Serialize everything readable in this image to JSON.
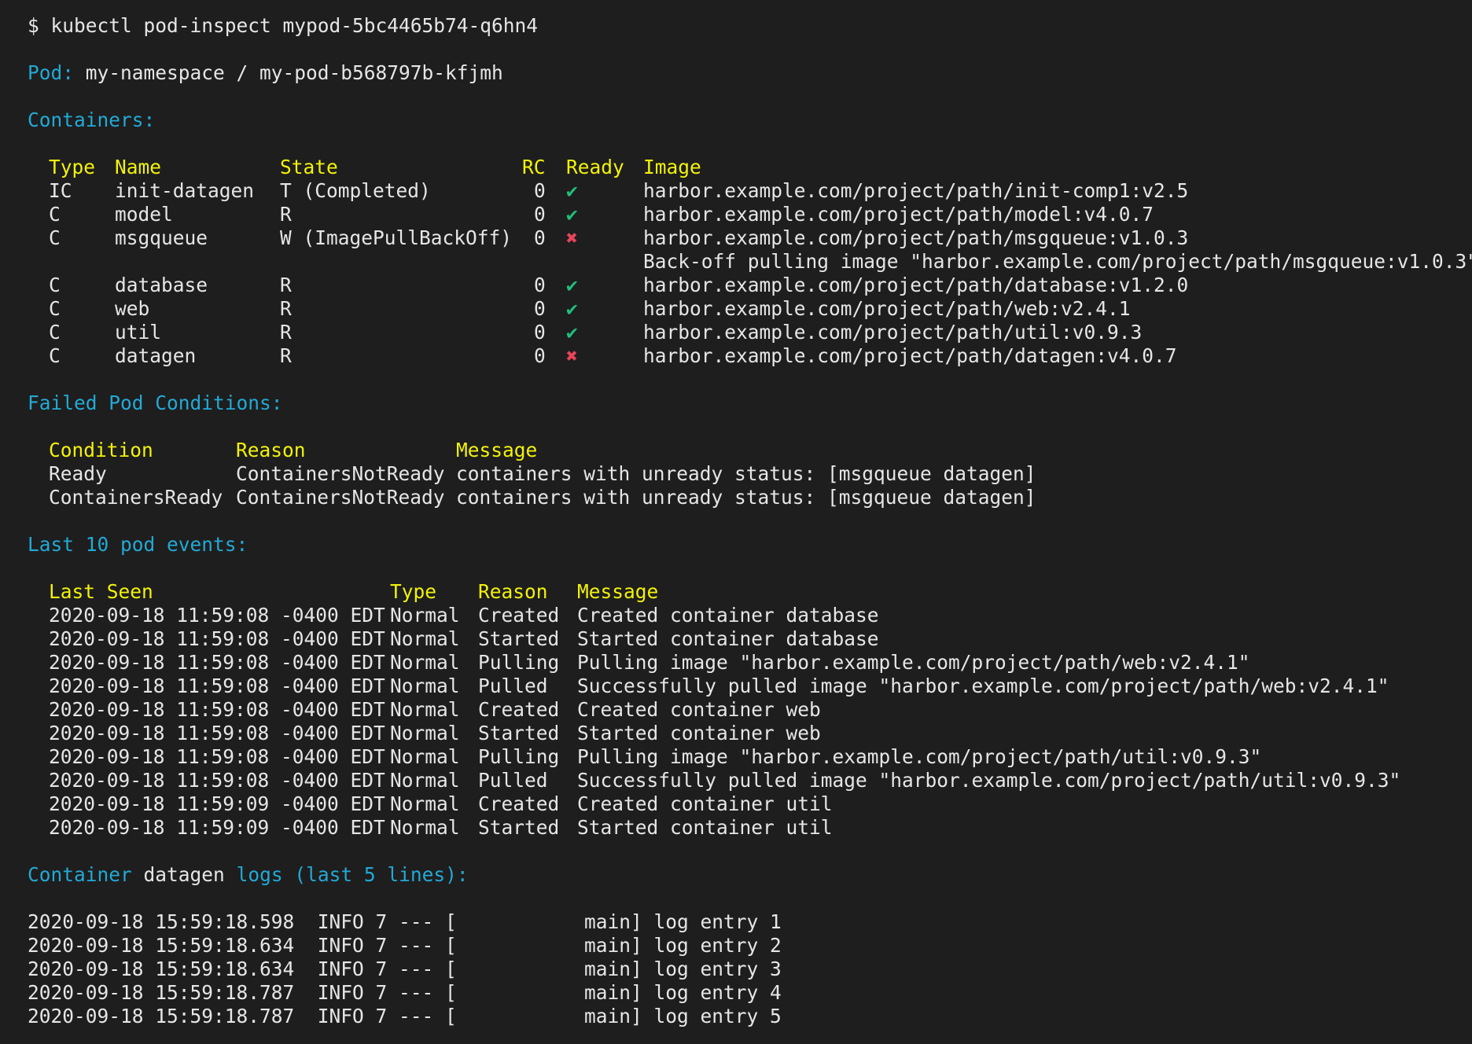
{
  "command": {
    "prompt": "$",
    "text": "kubectl pod-inspect mypod-5bc4465b74-q6hn4"
  },
  "pod": {
    "label": "Pod:",
    "value": "my-namespace / my-pod-b568797b-kfjmh"
  },
  "containers": {
    "heading": "Containers:",
    "headers": {
      "type": "Type",
      "name": "Name",
      "state": "State",
      "rc": "RC",
      "ready": "Ready",
      "image": "Image"
    },
    "rows": [
      {
        "type": "IC",
        "name": "init-datagen",
        "state": "T (Completed)",
        "rc": "0",
        "ready": "✔",
        "ready_ok": true,
        "image": "harbor.example.com/project/path/init-comp1:v2.5"
      },
      {
        "type": "C",
        "name": "model",
        "state": "R",
        "rc": "0",
        "ready": "✔",
        "ready_ok": true,
        "image": "harbor.example.com/project/path/model:v4.0.7"
      },
      {
        "type": "C",
        "name": "msgqueue",
        "state": "W (ImagePullBackOff)",
        "rc": "0",
        "ready": "✖",
        "ready_ok": false,
        "image": "harbor.example.com/project/path/msgqueue:v1.0.3",
        "detail": "Back-off pulling image \"harbor.example.com/project/path/msgqueue:v1.0.3\""
      },
      {
        "type": "C",
        "name": "database",
        "state": "R",
        "rc": "0",
        "ready": "✔",
        "ready_ok": true,
        "image": "harbor.example.com/project/path/database:v1.2.0"
      },
      {
        "type": "C",
        "name": "web",
        "state": "R",
        "rc": "0",
        "ready": "✔",
        "ready_ok": true,
        "image": "harbor.example.com/project/path/web:v2.4.1"
      },
      {
        "type": "C",
        "name": "util",
        "state": "R",
        "rc": "0",
        "ready": "✔",
        "ready_ok": true,
        "image": "harbor.example.com/project/path/util:v0.9.3"
      },
      {
        "type": "C",
        "name": "datagen",
        "state": "R",
        "rc": "0",
        "ready": "✖",
        "ready_ok": false,
        "image": "harbor.example.com/project/path/datagen:v4.0.7"
      }
    ]
  },
  "conditions": {
    "heading": "Failed Pod Conditions:",
    "headers": {
      "condition": "Condition",
      "reason": "Reason",
      "message": "Message"
    },
    "rows": [
      {
        "condition": "Ready",
        "reason": "ContainersNotReady",
        "message": "containers with unready status: [msgqueue datagen]"
      },
      {
        "condition": "ContainersReady",
        "reason": "ContainersNotReady",
        "message": "containers with unready status: [msgqueue datagen]"
      }
    ]
  },
  "events": {
    "heading": "Last 10 pod events:",
    "headers": {
      "last_seen": "Last Seen",
      "type": "Type",
      "reason": "Reason",
      "message": "Message"
    },
    "rows": [
      {
        "last_seen": "2020-09-18 11:59:08 -0400 EDT",
        "type": "Normal",
        "reason": "Created",
        "message": "Created container database"
      },
      {
        "last_seen": "2020-09-18 11:59:08 -0400 EDT",
        "type": "Normal",
        "reason": "Started",
        "message": "Started container database"
      },
      {
        "last_seen": "2020-09-18 11:59:08 -0400 EDT",
        "type": "Normal",
        "reason": "Pulling",
        "message": "Pulling image \"harbor.example.com/project/path/web:v2.4.1\""
      },
      {
        "last_seen": "2020-09-18 11:59:08 -0400 EDT",
        "type": "Normal",
        "reason": "Pulled",
        "message": "Successfully pulled image \"harbor.example.com/project/path/web:v2.4.1\""
      },
      {
        "last_seen": "2020-09-18 11:59:08 -0400 EDT",
        "type": "Normal",
        "reason": "Created",
        "message": "Created container web"
      },
      {
        "last_seen": "2020-09-18 11:59:08 -0400 EDT",
        "type": "Normal",
        "reason": "Started",
        "message": "Started container web"
      },
      {
        "last_seen": "2020-09-18 11:59:08 -0400 EDT",
        "type": "Normal",
        "reason": "Pulling",
        "message": "Pulling image \"harbor.example.com/project/path/util:v0.9.3\""
      },
      {
        "last_seen": "2020-09-18 11:59:08 -0400 EDT",
        "type": "Normal",
        "reason": "Pulled",
        "message": "Successfully pulled image \"harbor.example.com/project/path/util:v0.9.3\""
      },
      {
        "last_seen": "2020-09-18 11:59:09 -0400 EDT",
        "type": "Normal",
        "reason": "Created",
        "message": "Created container util"
      },
      {
        "last_seen": "2020-09-18 11:59:09 -0400 EDT",
        "type": "Normal",
        "reason": "Started",
        "message": "Started container util"
      }
    ]
  },
  "logs": {
    "heading_prefix": "Container",
    "heading_container": "datagen",
    "heading_suffix": "logs (last 5 lines):",
    "lines": [
      "2020-09-18 15:59:18.598  INFO 7 --- [           main] log entry 1",
      "2020-09-18 15:59:18.634  INFO 7 --- [           main] log entry 2",
      "2020-09-18 15:59:18.634  INFO 7 --- [           main] log entry 3",
      "2020-09-18 15:59:18.787  INFO 7 --- [           main] log entry 4",
      "2020-09-18 15:59:18.787  INFO 7 --- [           main] log entry 5"
    ]
  },
  "colors": {
    "background": "#1e1e1e",
    "text": "#e6e6e6",
    "heading": "#23a9d5",
    "column_header": "#f2f20a",
    "ok": "#1fbf7a",
    "error": "#e8455a"
  }
}
